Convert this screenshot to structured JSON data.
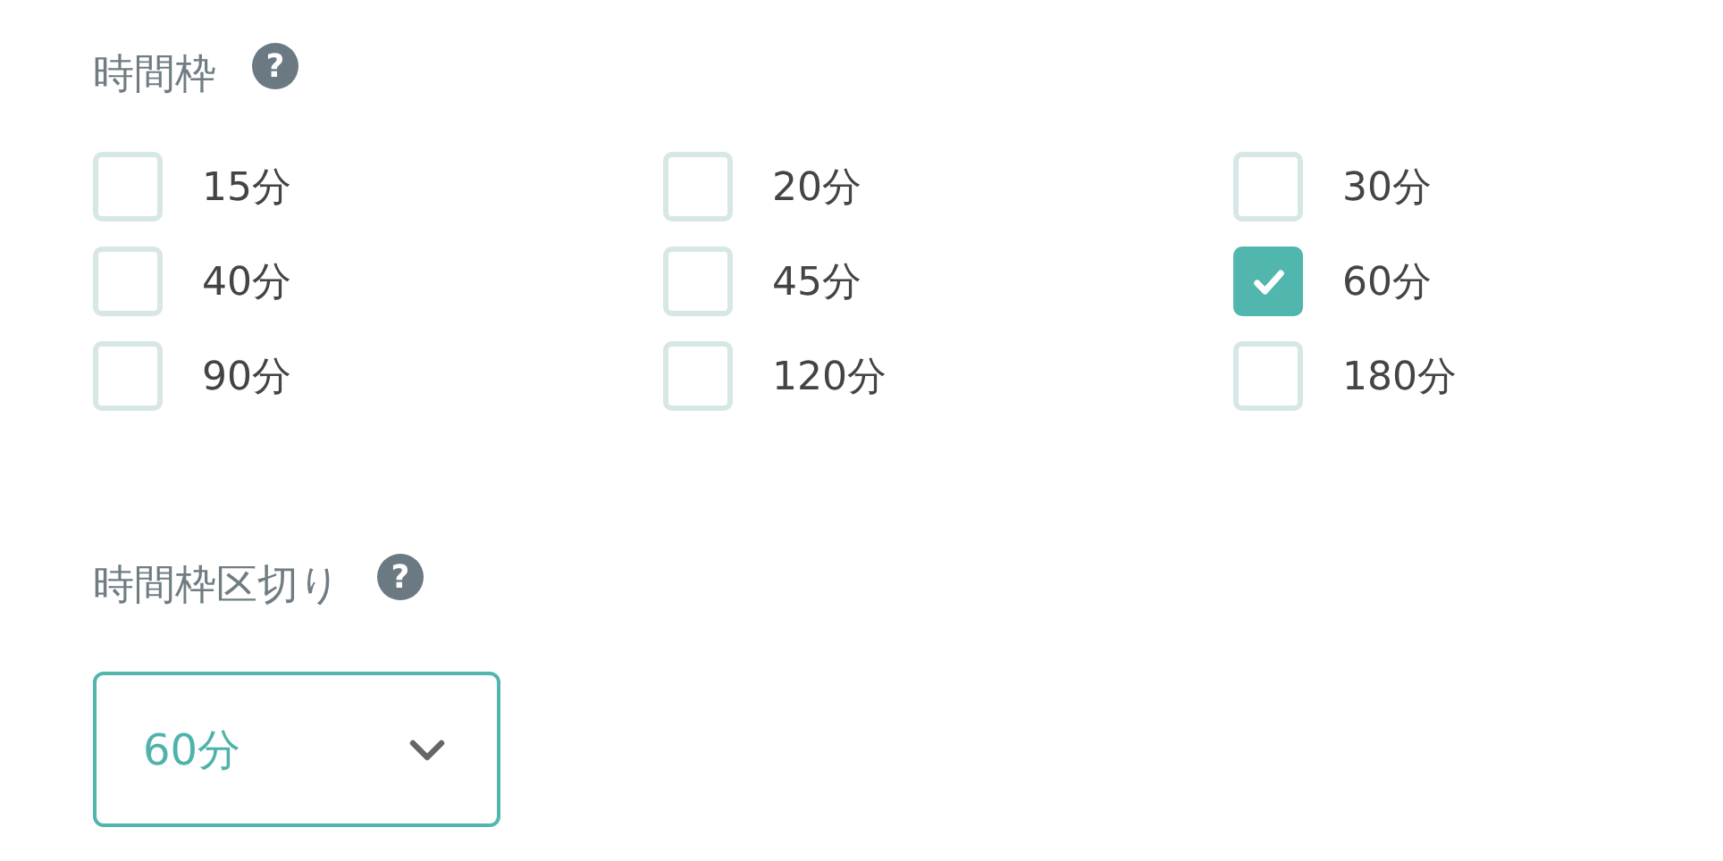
{
  "sections": [
    {
      "title": "時間枠",
      "help": "?",
      "kind": "checkboxes",
      "options": [
        {
          "label": "15分",
          "checked": false
        },
        {
          "label": "20分",
          "checked": false
        },
        {
          "label": "30分",
          "checked": false
        },
        {
          "label": "40分",
          "checked": false
        },
        {
          "label": "45分",
          "checked": false
        },
        {
          "label": "60分",
          "checked": true
        },
        {
          "label": "90分",
          "checked": false
        },
        {
          "label": "120分",
          "checked": false
        },
        {
          "label": "180分",
          "checked": false
        }
      ]
    },
    {
      "title": "時間枠区切り",
      "help": "?",
      "kind": "select",
      "value": "60分"
    }
  ]
}
